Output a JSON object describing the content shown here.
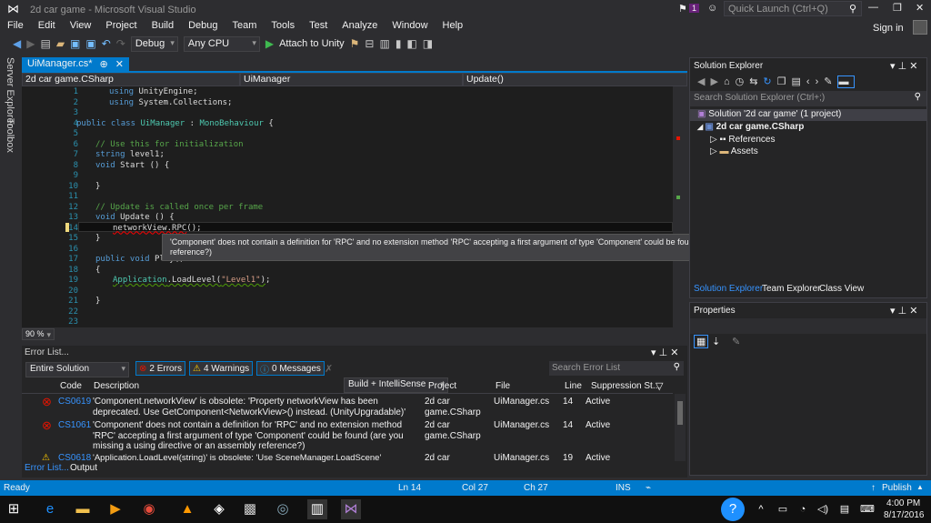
{
  "window": {
    "title": "2d car game - Microsoft Visual Studio",
    "notification_count": "1",
    "quick_launch_placeholder": "Quick Launch (Ctrl+Q)",
    "sign_in": "Sign in"
  },
  "menu": [
    "File",
    "Edit",
    "View",
    "Project",
    "Build",
    "Debug",
    "Team",
    "Tools",
    "Test",
    "Analyze",
    "Window",
    "Help"
  ],
  "toolbar": {
    "config": "Debug",
    "platform": "Any CPU",
    "run": "Attach to Unity"
  },
  "left_tabs": [
    "Server Explorer",
    "Toolbox"
  ],
  "document": {
    "tab": "UiManager.cs*",
    "nav_project": "2d car game.CSharp",
    "nav_class": "UiManager",
    "nav_member": "Update()",
    "zoom": "90 %"
  },
  "code_lines": [
    "1",
    "2",
    "3",
    "4",
    "5",
    "6",
    "7",
    "8",
    "9",
    "10",
    "11",
    "12",
    "13",
    "14",
    "15",
    "16",
    "17",
    "18",
    "19",
    "20",
    "21",
    "22",
    "23"
  ],
  "tooltip": "'Component' does not contain a definition for 'RPC' and no extension method 'RPC' accepting a first argument of type 'Component' could be found (are you missing a using directive or an assembly reference?)",
  "error_list": {
    "title": "Error List...",
    "scope": "Entire Solution",
    "errors": "2 Errors",
    "warnings": "4 Warnings",
    "messages": "0 Messages",
    "source": "Build + IntelliSense",
    "search_placeholder": "Search Error List",
    "columns": [
      "Code",
      "Description",
      "Project",
      "File",
      "Line",
      "Suppression St..."
    ],
    "rows": [
      {
        "type": "error",
        "code": "CS0619",
        "description": "'Component.networkView' is obsolete: 'Property networkView has been deprecated. Use GetComponent<NetworkView>() instead. (UnityUpgradable)'",
        "project": "2d car game.CSharp",
        "file": "UiManager.cs",
        "line": "14",
        "suppression": "Active"
      },
      {
        "type": "error",
        "code": "CS1061",
        "description": "'Component' does not contain a definition for 'RPC' and no extension method 'RPC' accepting a first argument of type 'Component' could be found (are you missing a using directive or an assembly reference?)",
        "project": "2d car game.CSharp",
        "file": "UiManager.cs",
        "line": "14",
        "suppression": "Active"
      },
      {
        "type": "warning",
        "code": "CS0618",
        "description": "'Application.LoadLevel(string)' is obsolete: 'Use SceneManager.LoadScene'",
        "project": "2d car",
        "file": "UiManager.cs",
        "line": "19",
        "suppression": "Active"
      }
    ],
    "tabs": [
      "Error List...",
      "Output"
    ]
  },
  "solution_explorer": {
    "title": "Solution Explorer",
    "search_placeholder": "Search Solution Explorer (Ctrl+;)",
    "solution": "Solution '2d car game' (1 project)",
    "project": "2d car game.CSharp",
    "items": [
      "References",
      "Assets"
    ],
    "tabs": [
      "Solution Explorer",
      "Team Explorer",
      "Class View"
    ]
  },
  "properties": {
    "title": "Properties"
  },
  "status": {
    "text": "Ready",
    "ln": "Ln 14",
    "col": "Col 27",
    "ch": "Ch 27",
    "mode": "INS",
    "publish": "Publish"
  },
  "taskbar": {
    "time": "4:00 PM",
    "date": "8/17/2016"
  }
}
